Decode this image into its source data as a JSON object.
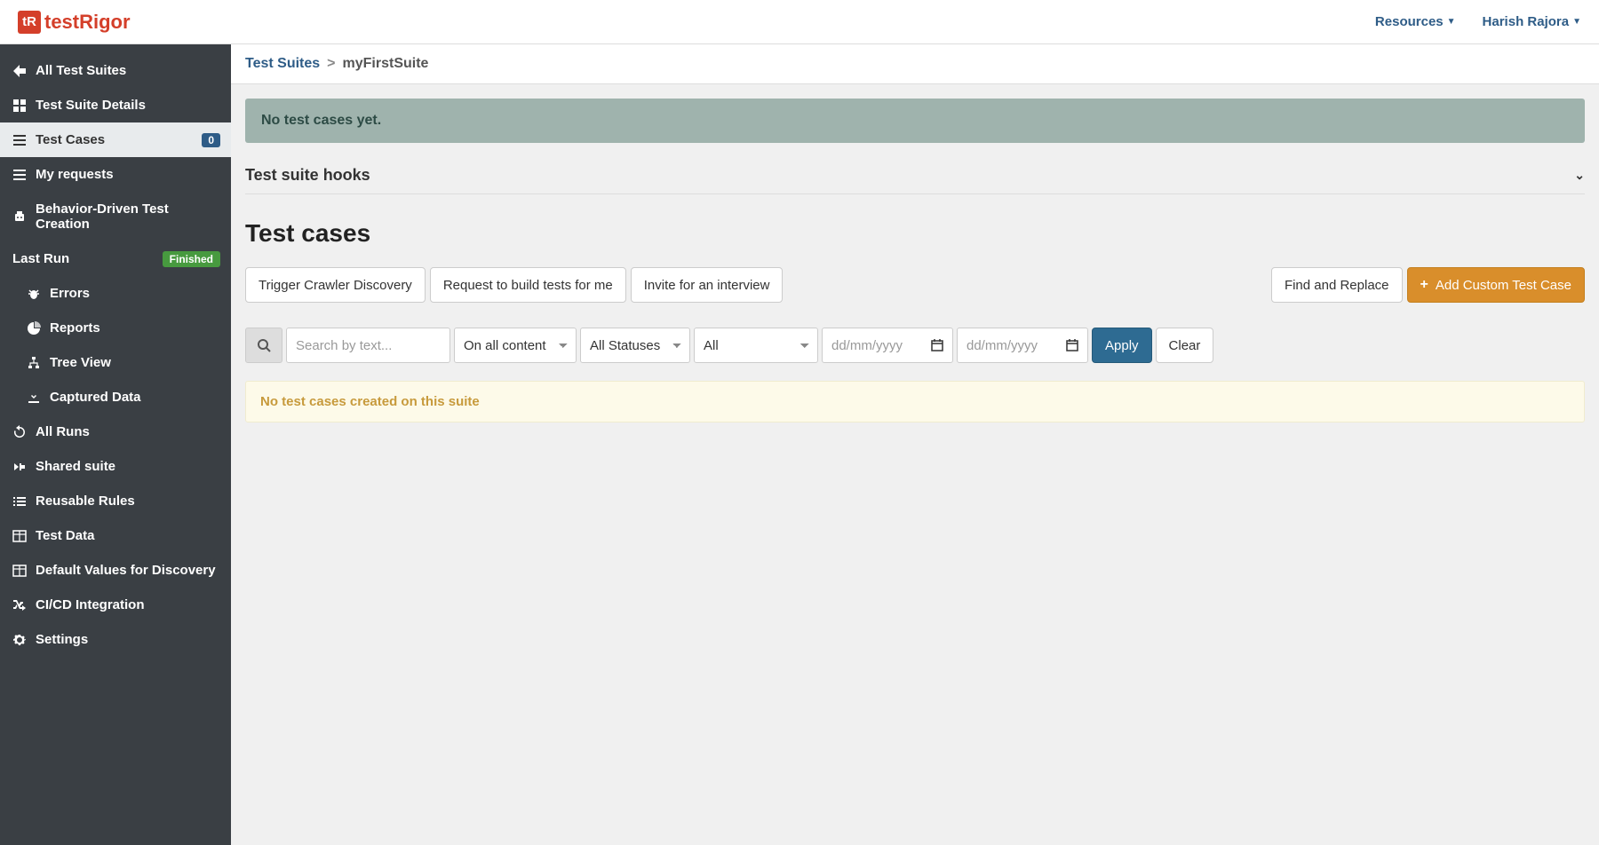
{
  "topbar": {
    "logo_badge": "tR",
    "logo_text": "testRigor",
    "resources": "Resources",
    "user": "Harish Rajora"
  },
  "breadcrumb": {
    "root": "Test Suites",
    "sep": ">",
    "current": "myFirstSuite"
  },
  "sidebar": {
    "all_suites": "All Test Suites",
    "details": "Test Suite Details",
    "test_cases": "Test Cases",
    "test_cases_count": "0",
    "my_requests": "My requests",
    "bdd": "Behavior-Driven Test Creation",
    "last_run": "Last Run",
    "last_run_status": "Finished",
    "errors": "Errors",
    "reports": "Reports",
    "tree_view": "Tree View",
    "captured_data": "Captured Data",
    "all_runs": "All Runs",
    "shared_suite": "Shared suite",
    "reusable_rules": "Reusable Rules",
    "test_data": "Test Data",
    "default_values": "Default Values for Discovery",
    "cicd": "CI/CD Integration",
    "settings": "Settings"
  },
  "main": {
    "empty_alert": "No test cases yet.",
    "hooks_title": "Test suite hooks",
    "title": "Test cases",
    "btn_trigger": "Trigger Crawler Discovery",
    "btn_request": "Request to build tests for me",
    "btn_invite": "Invite for an interview",
    "btn_find_replace": "Find and Replace",
    "btn_add_custom": "Add Custom Test Case",
    "search_placeholder": "Search by text...",
    "select_content": "On all content",
    "select_status": "All Statuses",
    "select_all": "All",
    "date_placeholder": "dd/mm/yyyy",
    "btn_apply": "Apply",
    "btn_clear": "Clear",
    "warn": "No test cases created on this suite"
  }
}
